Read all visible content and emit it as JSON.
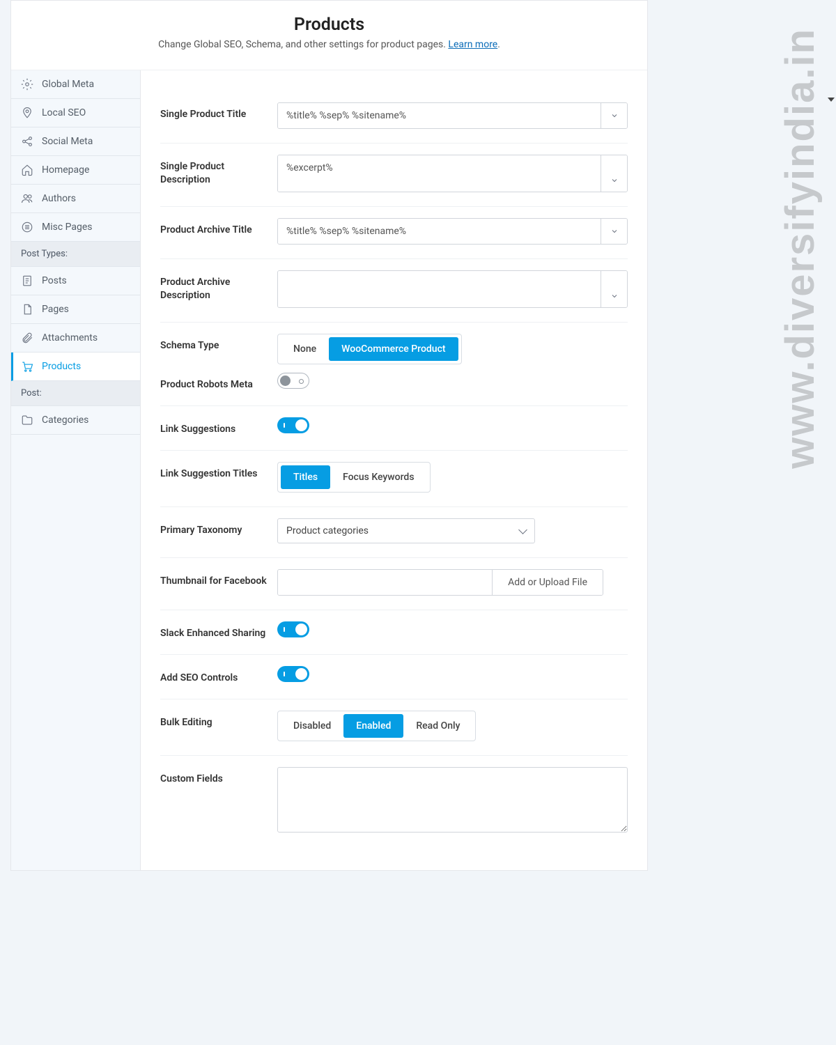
{
  "header": {
    "title": "Products",
    "subtitle_prefix": "Change Global SEO, Schema, and other settings for product pages. ",
    "learn_more": "Learn more"
  },
  "sidebar": {
    "items": [
      {
        "label": "Global Meta",
        "icon": "gear"
      },
      {
        "label": "Local SEO",
        "icon": "pin"
      },
      {
        "label": "Social Meta",
        "icon": "share"
      },
      {
        "label": "Homepage",
        "icon": "home"
      },
      {
        "label": "Authors",
        "icon": "users"
      },
      {
        "label": "Misc Pages",
        "icon": "list"
      }
    ],
    "section1_label": "Post Types:",
    "post_types": [
      {
        "label": "Posts",
        "icon": "doc"
      },
      {
        "label": "Pages",
        "icon": "page"
      },
      {
        "label": "Attachments",
        "icon": "clip"
      },
      {
        "label": "Products",
        "icon": "cart",
        "active": true
      }
    ],
    "section2_label": "Post:",
    "post_items": [
      {
        "label": "Categories",
        "icon": "folder"
      }
    ]
  },
  "fields": {
    "single_title": {
      "label": "Single Product Title",
      "value": "%title% %sep% %sitename%"
    },
    "single_desc": {
      "label": "Single Product Description",
      "value": "%excerpt%"
    },
    "archive_title": {
      "label": "Product Archive Title",
      "value": "%title% %sep% %sitename%"
    },
    "archive_desc": {
      "label": "Product Archive Description",
      "value": ""
    },
    "schema_type": {
      "label": "Schema Type",
      "options": [
        "None",
        "WooCommerce Product"
      ],
      "selected": 1
    },
    "robots": {
      "label": "Product Robots Meta",
      "on": false
    },
    "link_sugg": {
      "label": "Link Suggestions",
      "on": true
    },
    "link_sugg_titles": {
      "label": "Link Suggestion Titles",
      "options": [
        "Titles",
        "Focus Keywords"
      ],
      "selected": 0
    },
    "primary_tax": {
      "label": "Primary Taxonomy",
      "value": "Product categories"
    },
    "fb_thumb": {
      "label": "Thumbnail for Facebook",
      "button": "Add or Upload File"
    },
    "slack": {
      "label": "Slack Enhanced Sharing",
      "on": true
    },
    "seo_controls": {
      "label": "Add SEO Controls",
      "on": true
    },
    "bulk_edit": {
      "label": "Bulk Editing",
      "options": [
        "Disabled",
        "Enabled",
        "Read Only"
      ],
      "selected": 1
    },
    "custom_fields": {
      "label": "Custom Fields",
      "value": ""
    }
  },
  "watermark": "www.diversifyindia.in"
}
